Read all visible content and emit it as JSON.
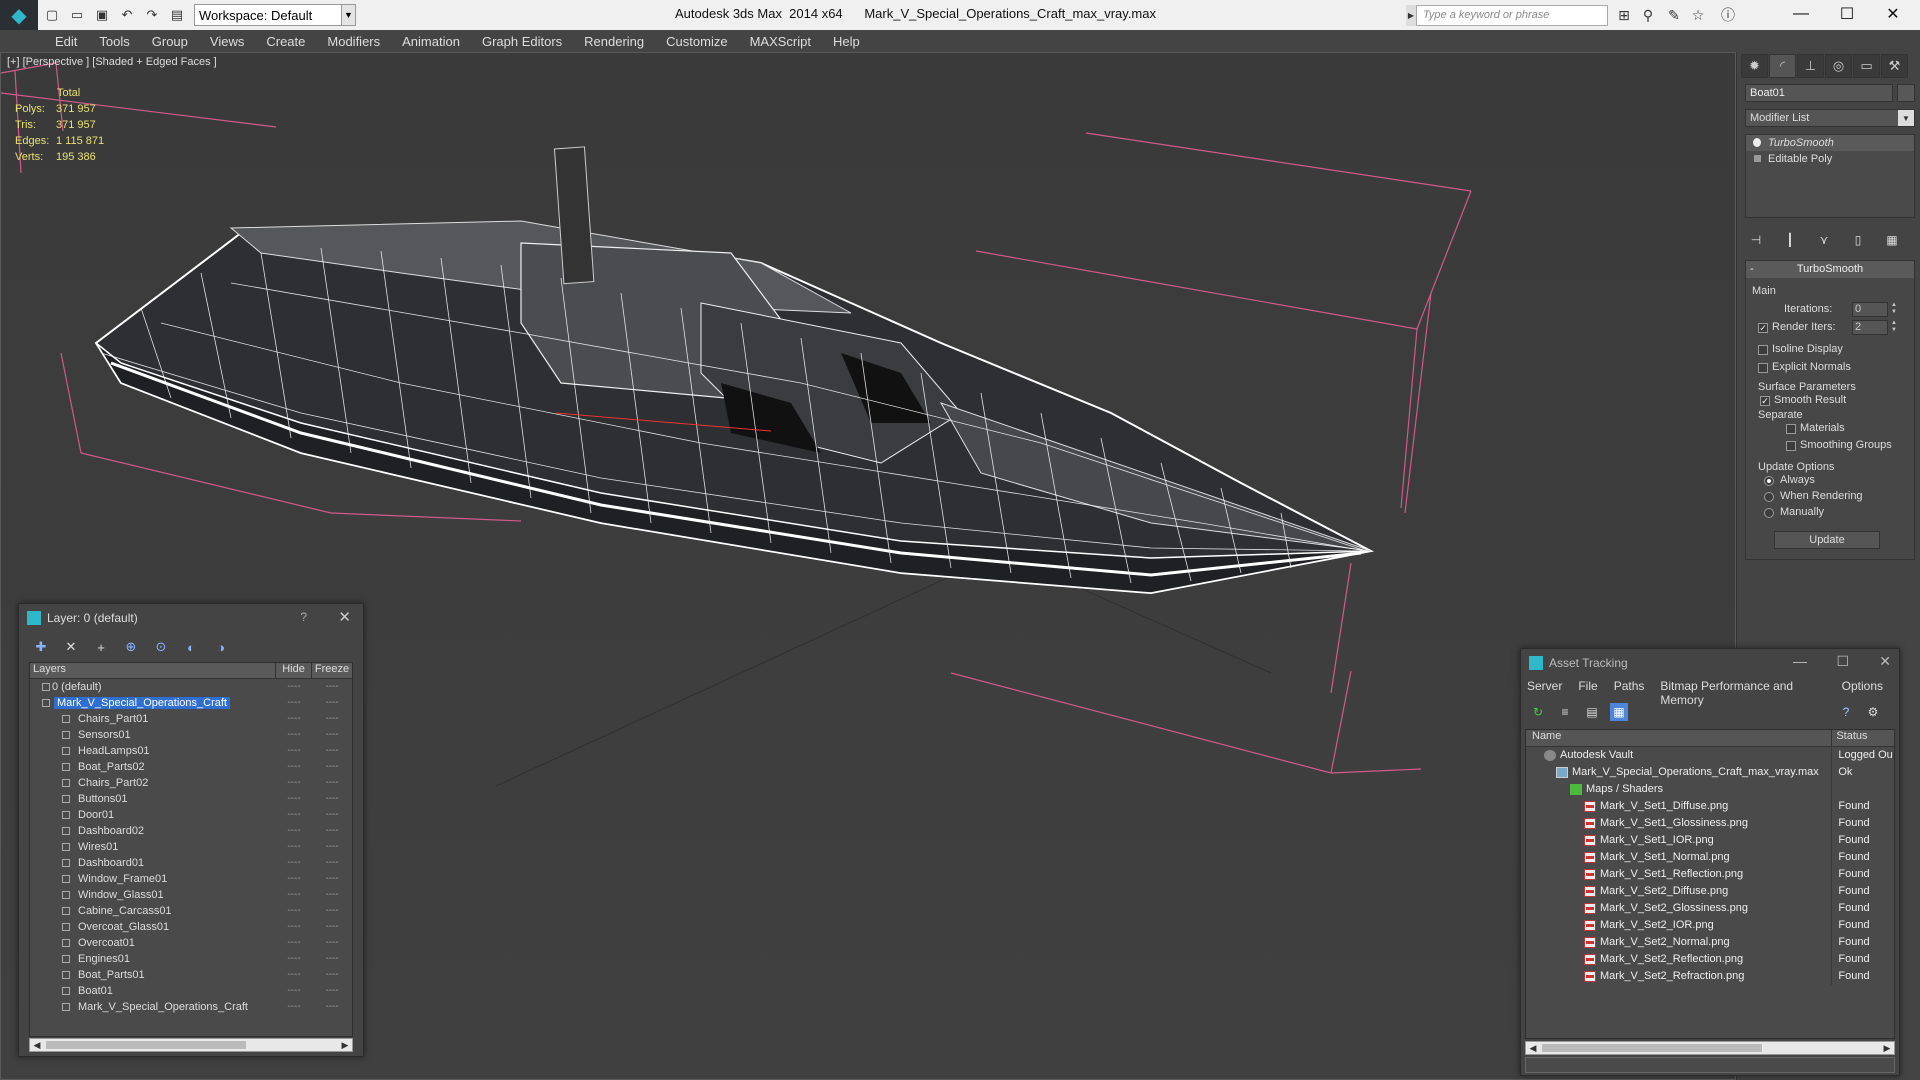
{
  "titlebar": {
    "workspace_label": "Workspace: Default",
    "window_title": "Autodesk 3ds Max  2014 x64      Mark_V_Special_Operations_Craft_max_vray.max",
    "search_placeholder": "Type a keyword or phrase",
    "minimize": "—",
    "maximize": "☐",
    "close": "✕"
  },
  "menu": [
    "Edit",
    "Tools",
    "Group",
    "Views",
    "Create",
    "Modifiers",
    "Animation",
    "Graph Editors",
    "Rendering",
    "Customize",
    "MAXScript",
    "Help"
  ],
  "viewport": {
    "label": "[+] [Perspective ] [Shaded + Edged Faces ]",
    "stats_header": "Total",
    "stats": [
      {
        "key": "Polys:",
        "value": "371 957"
      },
      {
        "key": "Tris:",
        "value": "371 957"
      },
      {
        "key": "Edges:",
        "value": "1 115 871"
      },
      {
        "key": "Verts:",
        "value": "195 386"
      }
    ]
  },
  "command_panel": {
    "object_name": "Boat01",
    "modifier_list": "Modifier List",
    "stack": [
      "TurboSmooth",
      "Editable Poly"
    ],
    "turbosmooth": {
      "header": "TurboSmooth",
      "main_label": "Main",
      "iterations_label": "Iterations:",
      "iterations_value": "0",
      "render_iters_label": "Render Iters:",
      "render_iters_value": "2",
      "isoline_label": "Isoline Display",
      "explicit_normals_label": "Explicit Normals",
      "surface_params_label": "Surface Parameters",
      "smooth_result_label": "Smooth Result",
      "separate_label": "Separate",
      "materials_label": "Materials",
      "smoothing_groups_label": "Smoothing Groups",
      "update_options_label": "Update Options",
      "always_label": "Always",
      "when_rendering_label": "When Rendering",
      "manually_label": "Manually",
      "update_button": "Update"
    }
  },
  "layer_dialog": {
    "title": "Layer: 0 (default)",
    "help": "?",
    "close": "✕",
    "col_layers": "Layers",
    "col_hide": "Hide",
    "col_freeze": "Freeze",
    "rows": [
      {
        "name": "0 (default)",
        "level": 0,
        "selected": false
      },
      {
        "name": "Mark_V_Special_Operations_Craft",
        "level": 1,
        "selected": true
      },
      {
        "name": "Chairs_Part01",
        "level": 2,
        "selected": false
      },
      {
        "name": "Sensors01",
        "level": 2,
        "selected": false
      },
      {
        "name": "HeadLamps01",
        "level": 2,
        "selected": false
      },
      {
        "name": "Boat_Parts02",
        "level": 2,
        "selected": false
      },
      {
        "name": "Chairs_Part02",
        "level": 2,
        "selected": false
      },
      {
        "name": "Buttons01",
        "level": 2,
        "selected": false
      },
      {
        "name": "Door01",
        "level": 2,
        "selected": false
      },
      {
        "name": "Dashboard02",
        "level": 2,
        "selected": false
      },
      {
        "name": "Wires01",
        "level": 2,
        "selected": false
      },
      {
        "name": "Dashboard01",
        "level": 2,
        "selected": false
      },
      {
        "name": "Window_Frame01",
        "level": 2,
        "selected": false
      },
      {
        "name": "Window_Glass01",
        "level": 2,
        "selected": false
      },
      {
        "name": "Cabine_Carcass01",
        "level": 2,
        "selected": false
      },
      {
        "name": "Overcoat_Glass01",
        "level": 2,
        "selected": false
      },
      {
        "name": "Overcoat01",
        "level": 2,
        "selected": false
      },
      {
        "name": "Engines01",
        "level": 2,
        "selected": false
      },
      {
        "name": "Boat_Parts01",
        "level": 2,
        "selected": false
      },
      {
        "name": "Boat01",
        "level": 2,
        "selected": false
      },
      {
        "name": "Mark_V_Special_Operations_Craft",
        "level": 2,
        "selected": false
      }
    ],
    "dash": "----"
  },
  "asset_dialog": {
    "title": "Asset Tracking",
    "menu": [
      "Server",
      "File",
      "Paths",
      "Bitmap Performance and Memory",
      "Options"
    ],
    "col_name": "Name",
    "col_status": "Status",
    "rows": [
      {
        "name": "Autodesk Vault",
        "status": "Logged Ou",
        "icon": "vault",
        "indent": 18
      },
      {
        "name": "Mark_V_Special_Operations_Craft_max_vray.max",
        "status": "Ok",
        "icon": "max",
        "indent": 30
      },
      {
        "name": "Maps / Shaders",
        "status": "",
        "icon": "maps",
        "indent": 44
      },
      {
        "name": "Mark_V_Set1_Diffuse.png",
        "status": "Found",
        "icon": "png",
        "indent": 58
      },
      {
        "name": "Mark_V_Set1_Glossiness.png",
        "status": "Found",
        "icon": "png",
        "indent": 58
      },
      {
        "name": "Mark_V_Set1_IOR.png",
        "status": "Found",
        "icon": "png",
        "indent": 58
      },
      {
        "name": "Mark_V_Set1_Normal.png",
        "status": "Found",
        "icon": "png",
        "indent": 58
      },
      {
        "name": "Mark_V_Set1_Reflection.png",
        "status": "Found",
        "icon": "png",
        "indent": 58
      },
      {
        "name": "Mark_V_Set2_Diffuse.png",
        "status": "Found",
        "icon": "png",
        "indent": 58
      },
      {
        "name": "Mark_V_Set2_Glossiness.png",
        "status": "Found",
        "icon": "png",
        "indent": 58
      },
      {
        "name": "Mark_V_Set2_IOR.png",
        "status": "Found",
        "icon": "png",
        "indent": 58
      },
      {
        "name": "Mark_V_Set2_Normal.png",
        "status": "Found",
        "icon": "png",
        "indent": 58
      },
      {
        "name": "Mark_V_Set2_Reflection.png",
        "status": "Found",
        "icon": "png",
        "indent": 58
      },
      {
        "name": "Mark_V_Set2_Refraction.png",
        "status": "Found",
        "icon": "png",
        "indent": 58
      }
    ]
  },
  "colors": {
    "accent_selection": "#2f6fd1",
    "stats_text": "#e8e070",
    "bounding_box": "#d05a8a",
    "wireframe": "#ffffff"
  }
}
